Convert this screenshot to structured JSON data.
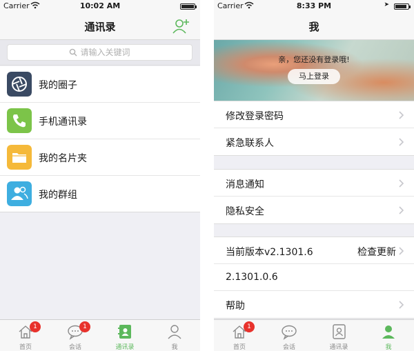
{
  "left": {
    "status": {
      "carrier": "Carrier",
      "time": "10:02 AM"
    },
    "title": "通讯录",
    "search_placeholder": "请输入关键词",
    "items": [
      {
        "label": "我的圈子",
        "icon": "aperture-icon",
        "color": "#3a4a63"
      },
      {
        "label": "手机通讯录",
        "icon": "phone-icon",
        "color": "#7cc449"
      },
      {
        "label": "我的名片夹",
        "icon": "folder-icon",
        "color": "#f5b93a"
      },
      {
        "label": "我的群组",
        "icon": "group-icon",
        "color": "#3eaee0"
      }
    ],
    "tabs": [
      {
        "label": "首页",
        "badge": "1"
      },
      {
        "label": "会话",
        "badge": "1"
      },
      {
        "label": "通讯录",
        "active": true
      },
      {
        "label": "我"
      }
    ]
  },
  "right": {
    "status": {
      "carrier": "Carrier",
      "time": "8:33 PM"
    },
    "title": "我",
    "banner": {
      "message": "亲，您还没有登录哦!",
      "login_label": "马上登录"
    },
    "group1": [
      {
        "label": "修改登录密码"
      },
      {
        "label": "紧急联系人"
      }
    ],
    "group2": [
      {
        "label": "消息通知"
      },
      {
        "label": "隐私安全"
      }
    ],
    "group3": {
      "version_label": "当前版本v2.1301.6",
      "check_update": "检查更新",
      "version_number": "2.1301.0.6",
      "help": "帮助"
    },
    "tabs": [
      {
        "label": "首页",
        "badge": "1"
      },
      {
        "label": "会话"
      },
      {
        "label": "通讯录"
      },
      {
        "label": "我",
        "active": true
      }
    ]
  },
  "colors": {
    "accent_green": "#5cb85c",
    "badge_red": "#e8322c",
    "battery_full": 1.0,
    "battery_right": 0.9
  }
}
